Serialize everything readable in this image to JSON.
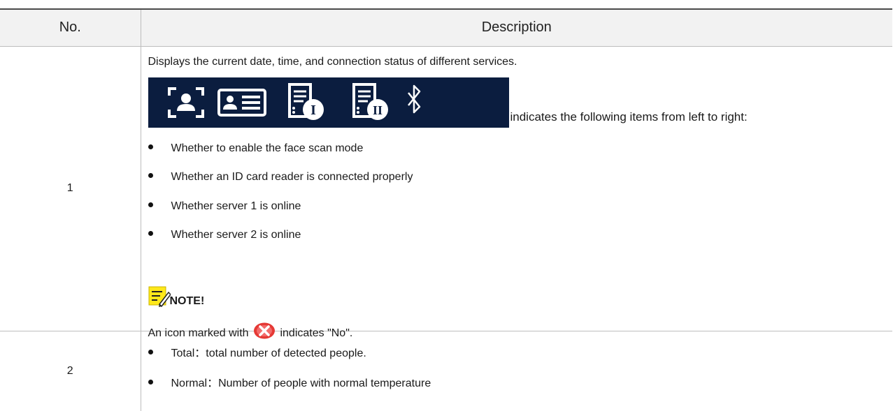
{
  "table": {
    "headers": {
      "no": "No.",
      "description": "Description"
    },
    "rows": [
      {
        "no": "1",
        "intro": "Displays the current date, time, and connection status of different services.",
        "status_icons": [
          "face-scan-icon",
          "id-card-icon",
          "server-1-icon",
          "server-2-icon",
          "bluetooth-icon"
        ],
        "indicates_text": "indicates the following items from left to right:",
        "bullets": [
          "Whether to enable the face scan mode",
          "Whether an ID card reader is connected properly",
          "Whether server 1 is online",
          "Whether server 2 is online"
        ],
        "note_label": "NOTE!",
        "icon_note_before": "An icon marked with",
        "icon_note_after": "indicates \"No\"."
      },
      {
        "no": "2",
        "bullets": [
          "Total：total number of detected people.",
          "Normal：Number of people with normal temperature"
        ]
      }
    ]
  },
  "colors": {
    "header_bg": "#f2f2f2",
    "icon_strip_bg": "#0b1d3f",
    "note_icon": "#ffe81a",
    "no_icon": "#e53935"
  }
}
